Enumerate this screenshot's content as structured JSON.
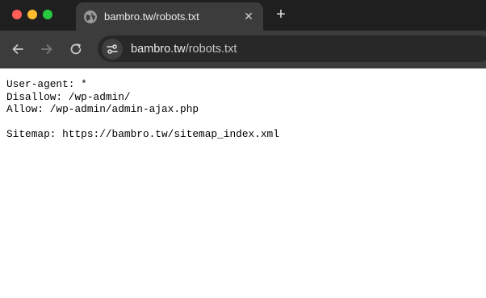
{
  "window": {
    "traffic_lights": {
      "close": "#ff5f57",
      "minimize": "#febc2e",
      "maximize": "#28c840"
    }
  },
  "tab": {
    "title": "bambro.tw/robots.txt",
    "icon": "globe-icon",
    "close_label": "✕"
  },
  "new_tab_label": "+",
  "toolbar": {
    "back_icon": "arrow-left-icon",
    "forward_icon": "arrow-right-icon",
    "reload_icon": "reload-icon",
    "site_info_icon": "tune-icon"
  },
  "address_bar": {
    "host": "bambro.tw",
    "path": "/robots.txt"
  },
  "document": {
    "lines": [
      "User-agent: *",
      "Disallow: /wp-admin/",
      "Allow: /wp-admin/admin-ajax.php",
      "",
      "Sitemap: https://bambro.tw/sitemap_index.xml"
    ]
  }
}
